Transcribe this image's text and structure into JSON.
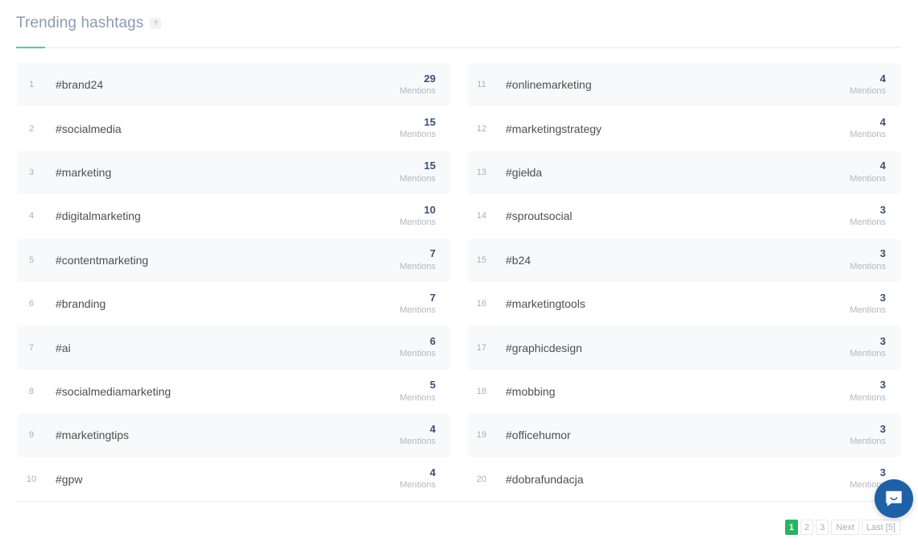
{
  "header": {
    "title": "Trending hashtags",
    "help_badge": "?",
    "accent_color": "#56cc9d"
  },
  "metric_label": "Mentions",
  "columns": [
    {
      "rows": [
        {
          "rank": "1",
          "hashtag": "#brand24",
          "mentions": "29",
          "label": "Mentions"
        },
        {
          "rank": "2",
          "hashtag": "#socialmedia",
          "mentions": "15",
          "label": "Mentions"
        },
        {
          "rank": "3",
          "hashtag": "#marketing",
          "mentions": "15",
          "label": "Mentions"
        },
        {
          "rank": "4",
          "hashtag": "#digitalmarketing",
          "mentions": "10",
          "label": "Mentions"
        },
        {
          "rank": "5",
          "hashtag": "#contentmarketing",
          "mentions": "7",
          "label": "Mentions"
        },
        {
          "rank": "6",
          "hashtag": "#branding",
          "mentions": "7",
          "label": "Mentions"
        },
        {
          "rank": "7",
          "hashtag": "#ai",
          "mentions": "6",
          "label": "Mentions"
        },
        {
          "rank": "8",
          "hashtag": "#socialmediamarketing",
          "mentions": "5",
          "label": "Mentions"
        },
        {
          "rank": "9",
          "hashtag": "#marketingtips",
          "mentions": "4",
          "label": "Mentions"
        },
        {
          "rank": "10",
          "hashtag": "#gpw",
          "mentions": "4",
          "label": "Mentions"
        }
      ]
    },
    {
      "rows": [
        {
          "rank": "11",
          "hashtag": "#onlinemarketing",
          "mentions": "4",
          "label": "Mentions"
        },
        {
          "rank": "12",
          "hashtag": "#marketingstrategy",
          "mentions": "4",
          "label": "Mentions"
        },
        {
          "rank": "13",
          "hashtag": "#giełda",
          "mentions": "4",
          "label": "Mentions"
        },
        {
          "rank": "14",
          "hashtag": "#sproutsocial",
          "mentions": "3",
          "label": "Mentions"
        },
        {
          "rank": "15",
          "hashtag": "#b24",
          "mentions": "3",
          "label": "Mentions"
        },
        {
          "rank": "16",
          "hashtag": "#marketingtools",
          "mentions": "3",
          "label": "Mentions"
        },
        {
          "rank": "17",
          "hashtag": "#graphicdesign",
          "mentions": "3",
          "label": "Mentions"
        },
        {
          "rank": "18",
          "hashtag": "#mobbing",
          "mentions": "3",
          "label": "Mentions"
        },
        {
          "rank": "19",
          "hashtag": "#officehumor",
          "mentions": "3",
          "label": "Mentions"
        },
        {
          "rank": "20",
          "hashtag": "#dobrafundacja",
          "mentions": "3",
          "label": "Mentions"
        }
      ]
    }
  ],
  "pagination": {
    "pages": [
      {
        "label": "1",
        "active": true,
        "name": "page-1"
      },
      {
        "label": "2",
        "active": false,
        "name": "page-2"
      },
      {
        "label": "3",
        "active": false,
        "name": "page-3"
      },
      {
        "label": "Next",
        "active": false,
        "name": "page-next"
      },
      {
        "label": "Last [5]",
        "active": false,
        "name": "page-last"
      }
    ],
    "active_color": "#29b463"
  },
  "intercom": {
    "icon": "chat-bubble-icon",
    "color": "#1f61a5"
  }
}
